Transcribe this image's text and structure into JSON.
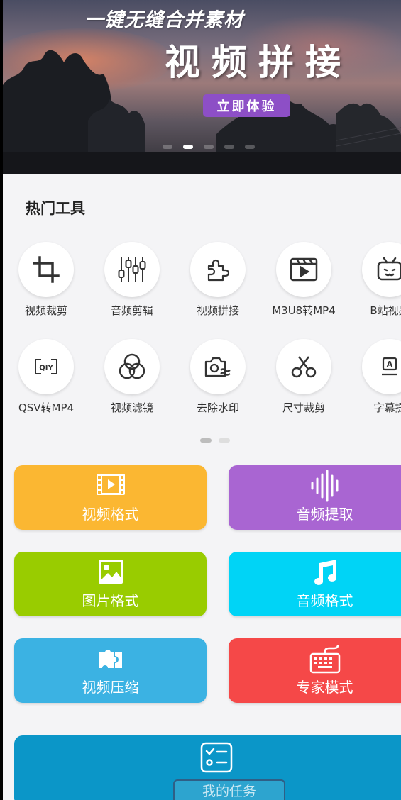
{
  "banner": {
    "subtitle": "一键无缝合并素材",
    "title": "视频拼接",
    "cta": "立即体验",
    "slide_count": 5,
    "active_slide": 2
  },
  "hot_tools": {
    "title": "热门工具",
    "items": [
      {
        "label": "视频裁剪",
        "icon": "crop-icon"
      },
      {
        "label": "音频剪辑",
        "icon": "sliders-icon"
      },
      {
        "label": "视频拼接",
        "icon": "puzzle-icon"
      },
      {
        "label": "M3U8转MP4",
        "icon": "clapperboard-play-icon"
      },
      {
        "label": "B站视频",
        "icon": "bilibili-tv-icon"
      },
      {
        "label": "QSV转MP4",
        "icon": "iqiyi-icon"
      },
      {
        "label": "视频滤镜",
        "icon": "filter-circles-icon"
      },
      {
        "label": "去除水印",
        "icon": "camera-wave-icon"
      },
      {
        "label": "尺寸裁剪",
        "icon": "scissors-icon"
      },
      {
        "label": "字幕提",
        "icon": "subtitle-a-icon"
      }
    ],
    "page_count": 2,
    "active_page": 1
  },
  "cards": [
    {
      "label": "视频格式",
      "icon": "film-strip-icon",
      "color": "#fbb732"
    },
    {
      "label": "音频提取",
      "icon": "waveform-icon",
      "color": "#a965d2"
    },
    {
      "label": "图片格式",
      "icon": "image-icon",
      "color": "#99cc00"
    },
    {
      "label": "音频格式",
      "icon": "music-note-icon",
      "color": "#00d4f6"
    },
    {
      "label": "视频压缩",
      "icon": "puzzle-compress-icon",
      "color": "#3bb2e3"
    },
    {
      "label": "专家模式",
      "icon": "keyboard-icon",
      "color": "#f54848"
    }
  ],
  "task": {
    "label": "我的任务",
    "icon": "task-list-icon",
    "color": "#0b96c8"
  }
}
